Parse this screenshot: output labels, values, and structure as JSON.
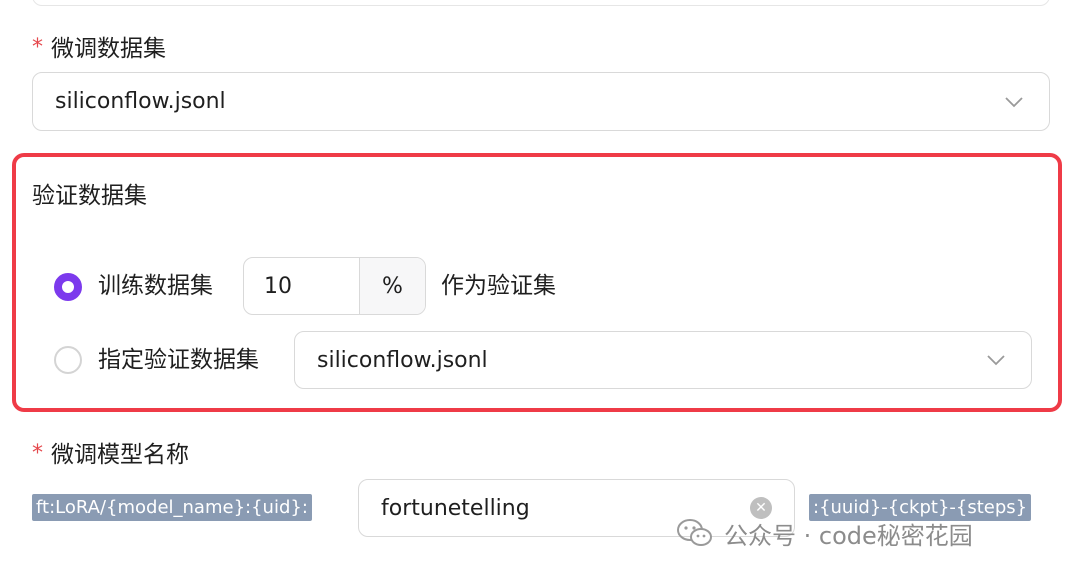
{
  "finetune_dataset": {
    "required_mark": "*",
    "label": "微调数据集",
    "selected_value": "siliconflow.jsonl"
  },
  "validation_dataset": {
    "label": "验证数据集",
    "option_train": {
      "label": "训练数据集",
      "percent_value": "10",
      "percent_unit": "%",
      "suffix": "作为验证集",
      "checked": true
    },
    "option_specify": {
      "label": "指定验证数据集",
      "selected_value": "siliconflow.jsonl",
      "checked": false
    }
  },
  "model_name": {
    "required_mark": "*",
    "label": "微调模型名称",
    "prefix": "ft:LoRA/{model_name}:{uid}:",
    "value": "fortunetelling",
    "suffix": ":{uuid}-{ckpt}-{steps}"
  },
  "watermark": {
    "text": "公众号 · code秘密花园"
  },
  "colors": {
    "accent": "#7c3aed",
    "highlight_border": "#ef3b47",
    "required": "#e5484d",
    "tag_bg": "#8a9bb3"
  },
  "icons": [
    "chevron-down-icon",
    "clear-icon",
    "wechat-icon"
  ]
}
